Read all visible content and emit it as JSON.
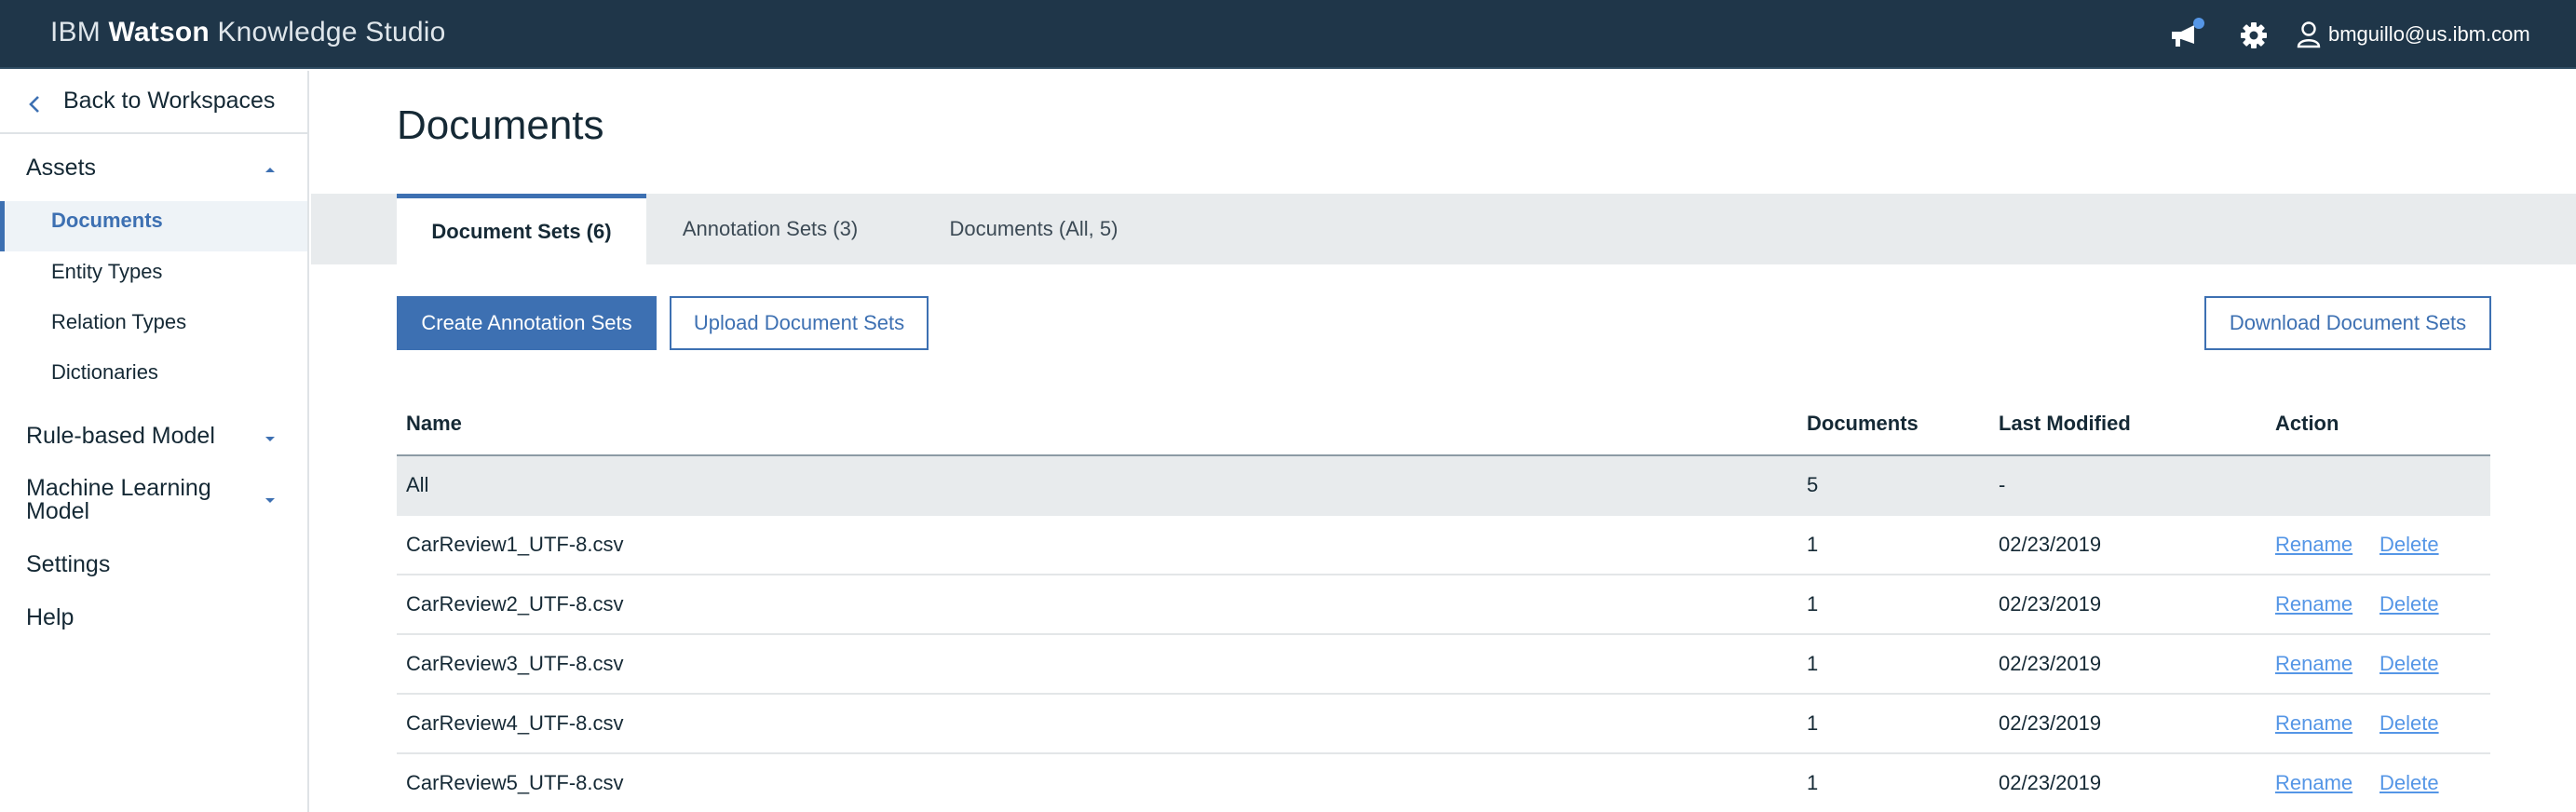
{
  "header": {
    "brand_prefix": "IBM",
    "brand_bold": "Watson",
    "brand_suffix": "Knowledge Studio",
    "icons": [
      "megaphone-icon",
      "gear-icon",
      "user-icon"
    ],
    "notification_dot_color": "#5596e6",
    "user_email": "bmguillo@us.ibm.com"
  },
  "sidebar": {
    "back_label": "Back to Workspaces",
    "assets_label": "Assets",
    "assets_items": [
      {
        "label": "Documents",
        "active": true
      },
      {
        "label": "Entity Types",
        "active": false
      },
      {
        "label": "Relation Types",
        "active": false
      },
      {
        "label": "Dictionaries",
        "active": false
      }
    ],
    "rule_based_label": "Rule-based Model",
    "ml_label_line1": "Machine Learning",
    "ml_label_line2": "Model",
    "settings_label": "Settings",
    "help_label": "Help"
  },
  "main": {
    "title": "Documents",
    "tabs": [
      {
        "label": "Document Sets (6)",
        "active": true
      },
      {
        "label": "Annotation Sets (3)",
        "active": false
      },
      {
        "label": "Documents (All, 5)",
        "active": false
      }
    ],
    "buttons": {
      "create_annotation_sets": "Create Annotation Sets",
      "upload_document_sets": "Upload Document Sets",
      "download_document_sets": "Download Document Sets"
    },
    "table": {
      "columns": [
        "Name",
        "Documents",
        "Last Modified",
        "Action"
      ],
      "all_row": {
        "name": "All",
        "documents": "5",
        "last_modified": "-"
      },
      "rows": [
        {
          "name": "CarReview1_UTF-8.csv",
          "documents": "1",
          "last_modified": "02/23/2019",
          "rename": "Rename",
          "delete": "Delete"
        },
        {
          "name": "CarReview2_UTF-8.csv",
          "documents": "1",
          "last_modified": "02/23/2019",
          "rename": "Rename",
          "delete": "Delete"
        },
        {
          "name": "CarReview3_UTF-8.csv",
          "documents": "1",
          "last_modified": "02/23/2019",
          "rename": "Rename",
          "delete": "Delete"
        },
        {
          "name": "CarReview4_UTF-8.csv",
          "documents": "1",
          "last_modified": "02/23/2019",
          "rename": "Rename",
          "delete": "Delete"
        },
        {
          "name": "CarReview5_UTF-8.csv",
          "documents": "1",
          "last_modified": "02/23/2019",
          "rename": "Rename",
          "delete": "Delete"
        }
      ]
    }
  },
  "colors": {
    "header_bg": "#1f3649",
    "accent": "#3d70b2",
    "link": "#5596e6",
    "tabbar_bg": "#e8ebed"
  }
}
